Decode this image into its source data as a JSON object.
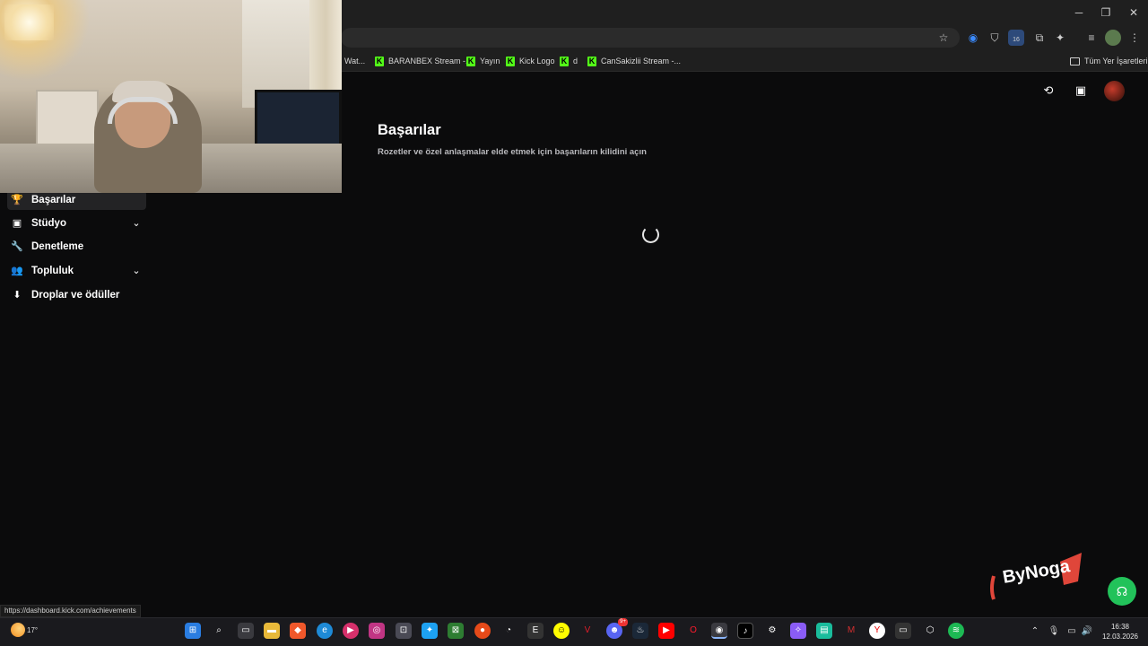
{
  "browser": {
    "window_controls": {
      "minimize": "─",
      "maximize": "❐",
      "close": "✕"
    },
    "bookmarks": [
      {
        "label": "Wat..."
      },
      {
        "label": "BARANBEX Stream -..."
      },
      {
        "label": "Yayın"
      },
      {
        "label": "Kick Logo"
      },
      {
        "label": "d"
      },
      {
        "label": "CanSakizlii Stream -..."
      }
    ],
    "all_bookmarks_label": "Tüm Yer İşaretleri",
    "extension_badge": "16"
  },
  "sidebar": {
    "items": [
      {
        "label": "Başarılar",
        "icon": "trophy-icon",
        "glyph": "🏆",
        "active": true,
        "expandable": false
      },
      {
        "label": "Stüdyo",
        "icon": "studio-icon",
        "glyph": "▣",
        "active": false,
        "expandable": true
      },
      {
        "label": "Denetleme",
        "icon": "wrench-icon",
        "glyph": "🔧",
        "active": false,
        "expandable": false
      },
      {
        "label": "Topluluk",
        "icon": "community-icon",
        "glyph": "👥",
        "active": false,
        "expandable": true
      },
      {
        "label": "Droplar ve ödüller",
        "icon": "drops-icon",
        "glyph": "⬇",
        "active": false,
        "expandable": false
      }
    ],
    "chevron": "⌄"
  },
  "main": {
    "title": "Başarılar",
    "subtitle": "Rozetler ve özel anlaşmalar elde etmek için başarıların kilidini açın"
  },
  "status_bar": {
    "url": "https://dashboard.kick.com/achievements"
  },
  "overlay_logo": {
    "text": "ByNoga"
  },
  "taskbar": {
    "weather_temp": "17°",
    "clock_time": "16:38",
    "clock_date": "12.03.2026",
    "notification_badge": "9+"
  },
  "colors": {
    "accent_green": "#53fc18",
    "support_green": "#22c25a",
    "background": "#0b0b0c"
  }
}
